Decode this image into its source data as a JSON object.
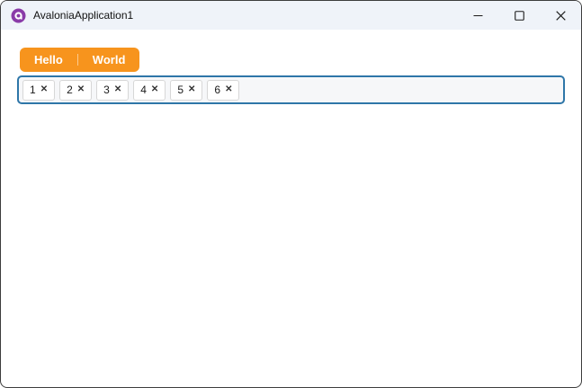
{
  "window": {
    "title": "AvaloniaApplication1"
  },
  "titlebar": {
    "buttons": [
      {
        "icon": "minimize"
      },
      {
        "icon": "maximize"
      },
      {
        "icon": "close"
      }
    ]
  },
  "tabs": {
    "items": [
      {
        "label": "Hello"
      },
      {
        "label": "World"
      }
    ]
  },
  "chip_input": {
    "chips": [
      {
        "label": "1"
      },
      {
        "label": "2"
      },
      {
        "label": "3"
      },
      {
        "label": "4"
      },
      {
        "label": "5"
      },
      {
        "label": "6"
      }
    ],
    "remove_icon": "✕"
  },
  "colors": {
    "accent_orange": "#F7941D",
    "focus_border": "#2E76A8",
    "titlebar_bg": "#EFF3F9",
    "window_border": "#3D3D3D"
  }
}
